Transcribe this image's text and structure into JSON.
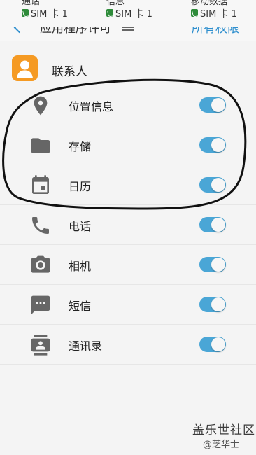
{
  "sim_strip": {
    "columns": [
      {
        "title": "通话",
        "sim": "SIM 卡 1"
      },
      {
        "title": "信息",
        "sim": "SIM 卡 1"
      },
      {
        "title": "移动数据",
        "sim": "SIM 卡 1"
      }
    ]
  },
  "action_bar": {
    "title": "应用程序许可",
    "right_link": "所有权限"
  },
  "app": {
    "name": "联系人",
    "icon": "contacts-app-icon",
    "icon_color": "#f59a23"
  },
  "permissions": [
    {
      "label": "位置信息",
      "icon": "location-icon",
      "enabled": true
    },
    {
      "label": "存储",
      "icon": "folder-icon",
      "enabled": true
    },
    {
      "label": "日历",
      "icon": "calendar-icon",
      "enabled": true
    },
    {
      "label": "电话",
      "icon": "phone-icon",
      "enabled": true
    },
    {
      "label": "相机",
      "icon": "camera-icon",
      "enabled": true
    },
    {
      "label": "短信",
      "icon": "sms-icon",
      "enabled": true
    },
    {
      "label": "通讯录",
      "icon": "contacts-icon",
      "enabled": true
    }
  ],
  "colors": {
    "accent": "#2f8fce",
    "toggle_on": "#4aa6d6",
    "icon_gray": "#666666"
  },
  "watermark": {
    "main": "盖乐世社区",
    "sub": "@芝华士"
  }
}
